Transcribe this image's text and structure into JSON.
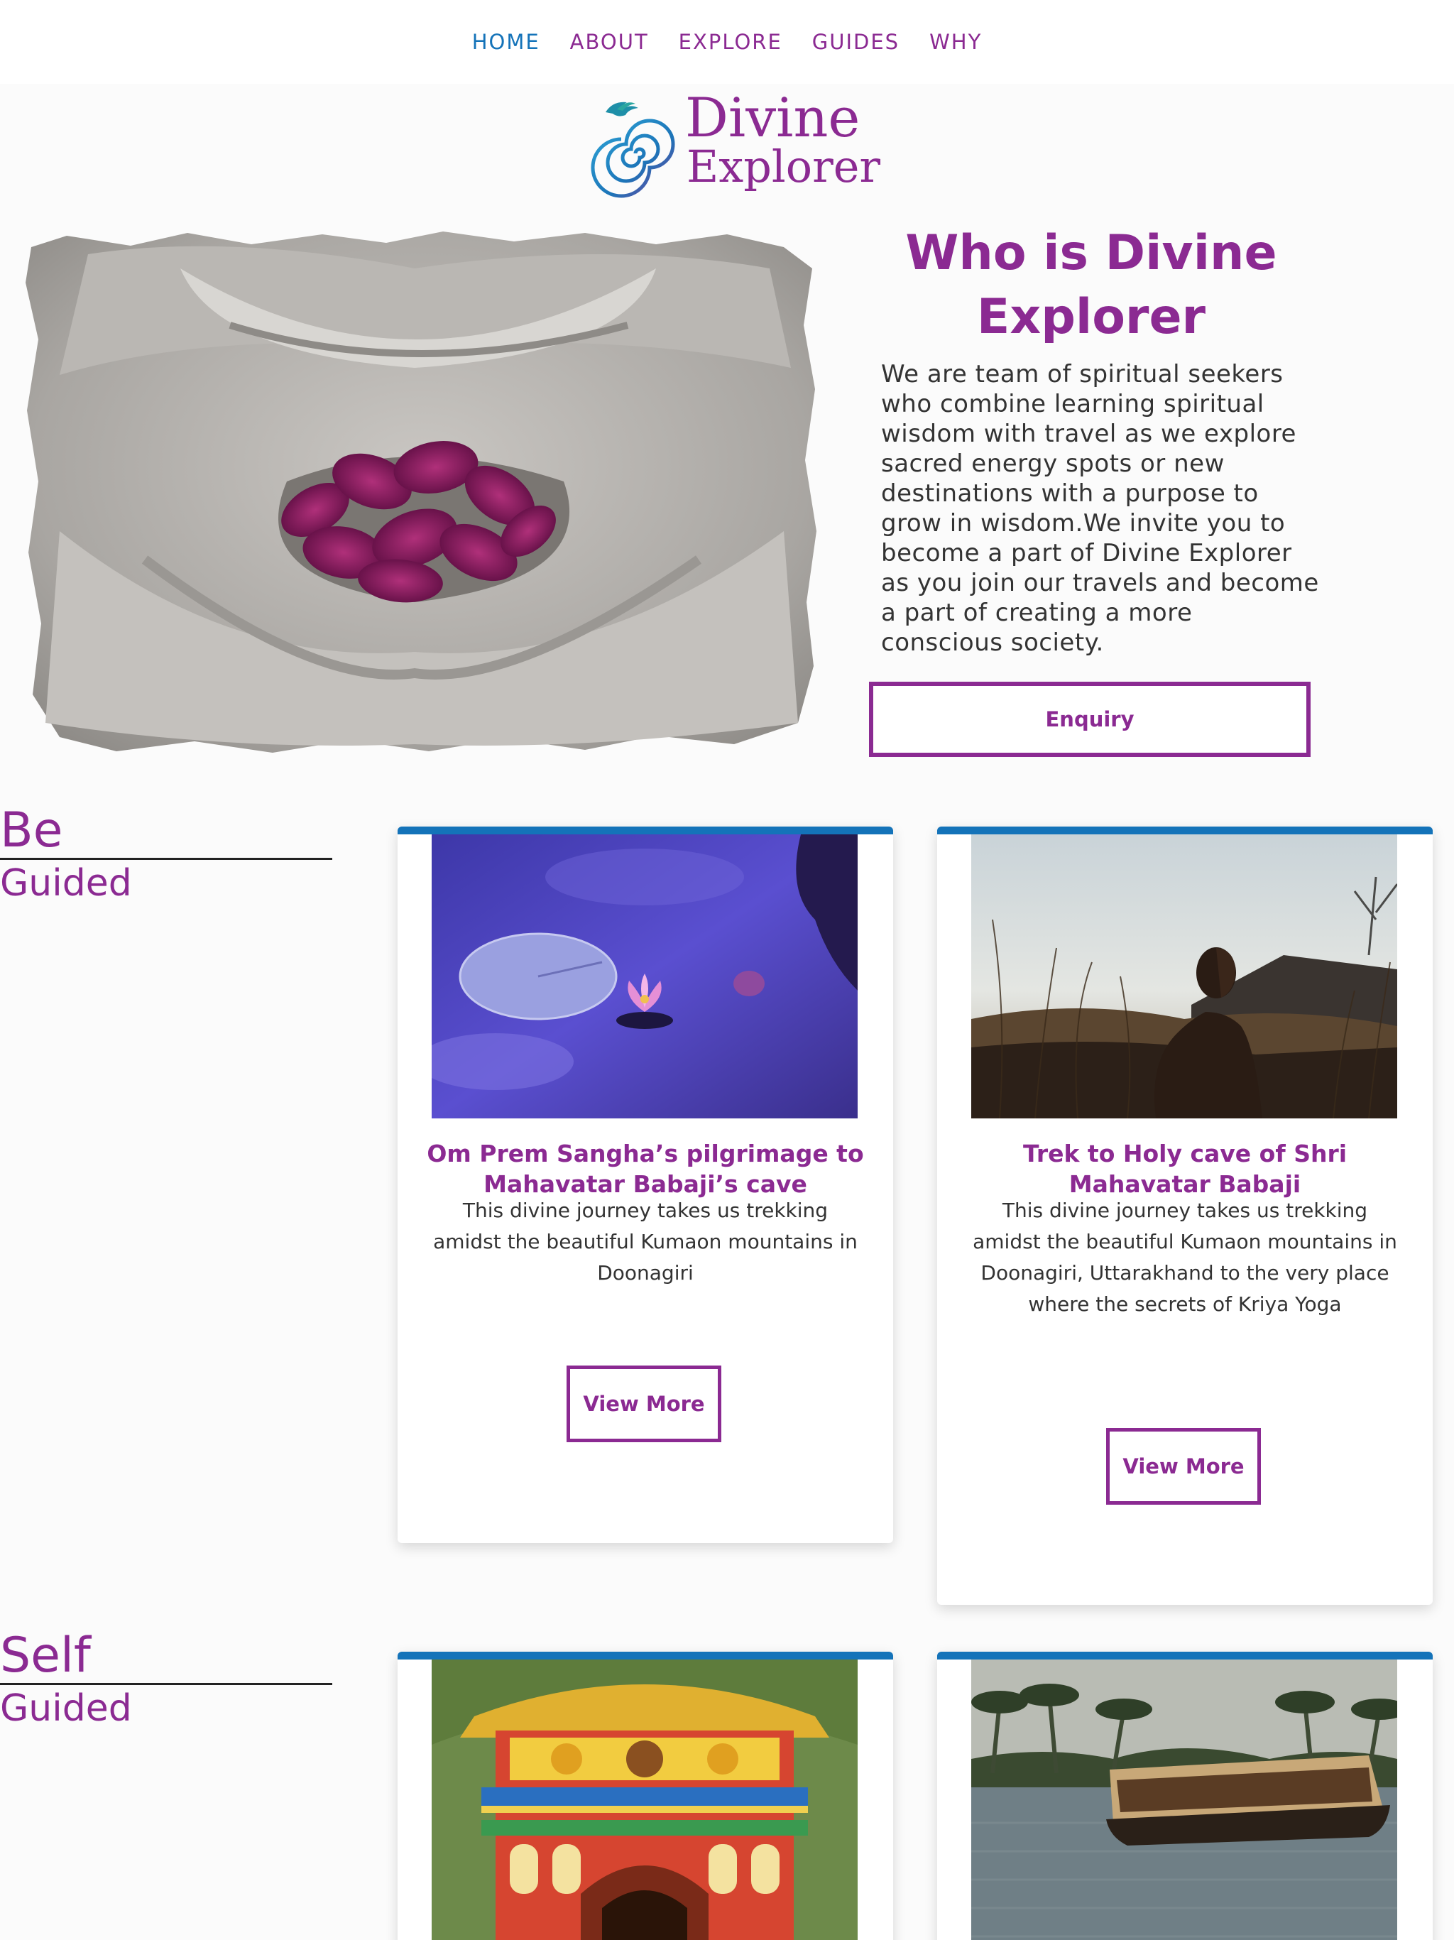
{
  "nav": {
    "items": [
      {
        "label": "HOME"
      },
      {
        "label": "ABOUT"
      },
      {
        "label": "EXPLORE"
      },
      {
        "label": "GUIDES"
      },
      {
        "label": "WHY"
      }
    ]
  },
  "logo": {
    "line1": "Divine",
    "line2": "Explorer"
  },
  "hero": {
    "title": "Who is Divine Explorer",
    "text": "We are team of spiritual seekers who combine learning spiritual wisdom with travel as we explore sacred energy spots or new destinations with a purpose to grow in wisdom.We invite you to become a part of Divine Explorer as you join our travels and become a part of creating a more conscious society.",
    "button": "Enquiry"
  },
  "sections": [
    {
      "big": "Be",
      "small": "Guided"
    },
    {
      "big": "Self",
      "small": "Guided"
    }
  ],
  "cards": [
    {
      "title": "Om Prem Sangha’s pilgrimage to Mahavatar Babaji’s cave",
      "desc": "This divine journey takes us  trekking amidst the beautiful Kumaon mountains in Doonagiri",
      "button": "View More"
    },
    {
      "title": "Trek to Holy cave of Shri Mahavatar Babaji",
      "desc": "This divine journey takes us  trekking amidst the beautiful Kumaon mountains in Doonagiri, Uttarakhand to the very place where the secrets of Kriya Yoga",
      "button": "View More"
    }
  ],
  "colors": {
    "accent": "#8b2a92",
    "nav_active": "#1473b9",
    "card_top": "#1473b9"
  }
}
